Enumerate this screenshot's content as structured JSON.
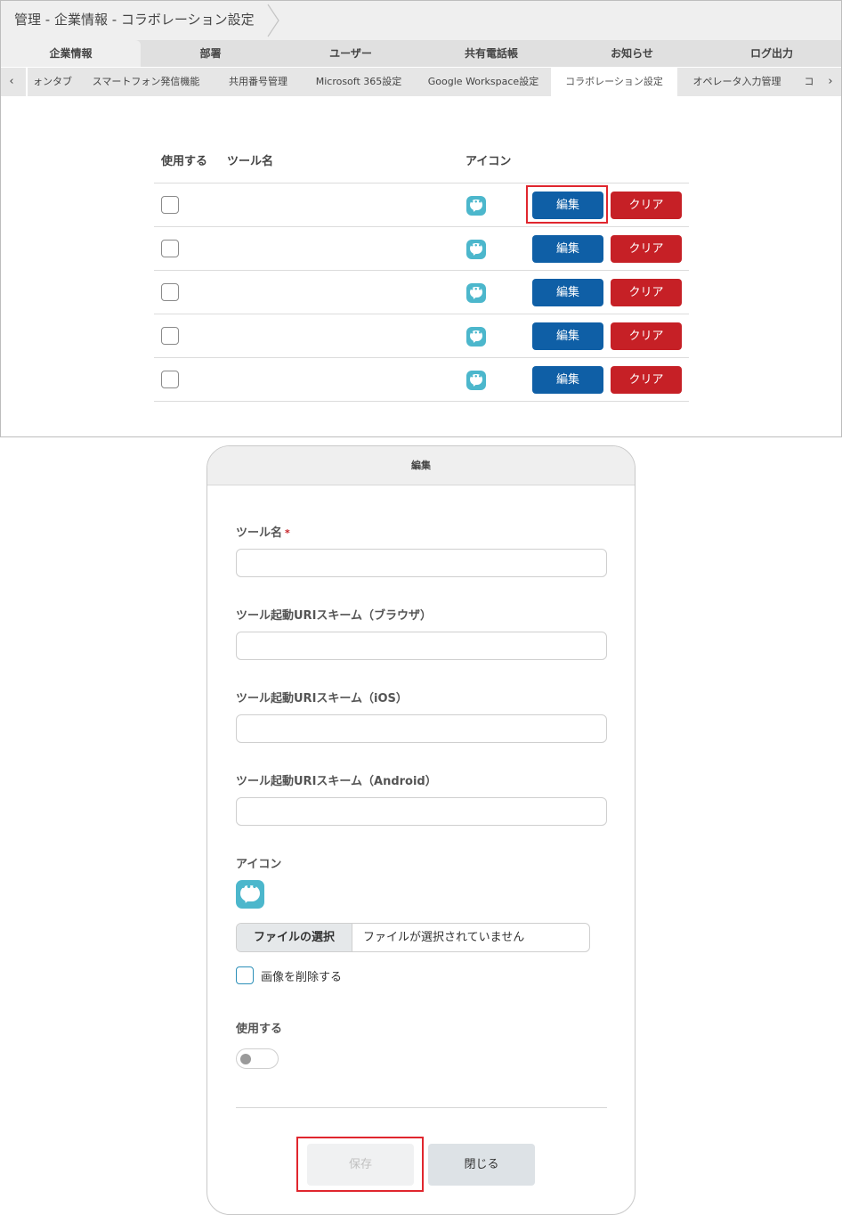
{
  "breadcrumb": "管理 - 企業情報 - コラボレーション設定",
  "main_tabs": [
    "企業情報",
    "部署",
    "ユーザー",
    "共有電話帳",
    "お知らせ",
    "ログ出力"
  ],
  "sub_tabs": [
    "ォンタブ",
    "スマートフォン発信機能",
    "共用番号管理",
    "Microsoft 365設定",
    "Google Workspace設定",
    "コラボレーション設定",
    "オペレータ入力管理",
    "コ"
  ],
  "sub_nav": {
    "prev": "‹",
    "next": "›"
  },
  "table": {
    "col_use": "使用する",
    "col_tool_name": "ツール名",
    "col_icon": "アイコン",
    "edit_label": "編集",
    "clear_label": "クリア",
    "rows": [
      {
        "tool_name": ""
      },
      {
        "tool_name": ""
      },
      {
        "tool_name": ""
      },
      {
        "tool_name": ""
      },
      {
        "tool_name": ""
      }
    ]
  },
  "modal": {
    "title": "編集",
    "tool_name_label": "ツール名",
    "required_mark": "*",
    "uri_browser_label": "ツール起動URIスキーム（ブラウザ）",
    "uri_ios_label": "ツール起動URIスキーム（iOS）",
    "uri_android_label": "ツール起動URIスキーム（Android）",
    "icon_label": "アイコン",
    "file_button": "ファイルの選択",
    "file_status": "ファイルが選択されていません",
    "delete_image_label": "画像を削除する",
    "use_label": "使用する",
    "save_label": "保存",
    "close_label": "閉じる"
  },
  "colors": {
    "edit_button": "#0f5fa6",
    "clear_button": "#c62026",
    "icon_accent": "#4cb7cc",
    "highlight": "#e0262e"
  }
}
